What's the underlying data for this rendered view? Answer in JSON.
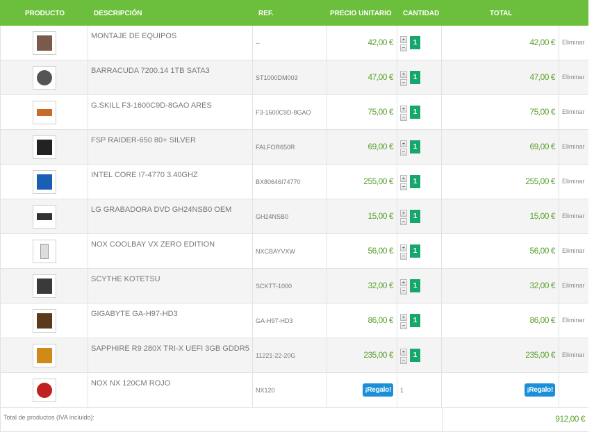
{
  "header": {
    "producto": "PRODUCTO",
    "descripcion": "DESCRIPCIÓN",
    "ref": "REF.",
    "precio": "PRECIO UNITARIO",
    "cantidad": "CANTIDAD",
    "total": "TOTAL"
  },
  "controls": {
    "plus": "+",
    "minus": "−",
    "delete": "Eliminar"
  },
  "items": [
    {
      "name": "MONTAJE DE EQUIPOS",
      "ref": "--",
      "price": "42,00 €",
      "qty": "1",
      "total": "42,00 €",
      "icon": "pc-assembly-icon",
      "color": "#7a5a4a"
    },
    {
      "name": "BARRACUDA 7200.14 1TB SATA3",
      "ref": "ST1000DM003",
      "price": "47,00 €",
      "qty": "1",
      "total": "47,00 €",
      "icon": "hard-drive-icon",
      "color": "#555555"
    },
    {
      "name": "G.SKILL F3-1600C9D-8GAO ARES",
      "ref": "F3-1600C9D-8GAO",
      "price": "75,00 €",
      "qty": "1",
      "total": "75,00 €",
      "icon": "ram-module-icon",
      "color": "#c86a2a"
    },
    {
      "name": "FSP RAIDER-650 80+ SILVER",
      "ref": "FALFOR650R",
      "price": "69,00 €",
      "qty": "1",
      "total": "69,00 €",
      "icon": "power-supply-icon",
      "color": "#222222"
    },
    {
      "name": "INTEL CORE I7-4770 3.40GHZ",
      "ref": "BX80646I74770",
      "price": "255,00 €",
      "qty": "1",
      "total": "255,00 €",
      "icon": "cpu-box-icon",
      "color": "#1a5fb4"
    },
    {
      "name": "LG GRABADORA DVD GH24NSB0 OEM",
      "ref": "GH24NSB0",
      "price": "15,00 €",
      "qty": "1",
      "total": "15,00 €",
      "icon": "dvd-drive-icon",
      "color": "#333333"
    },
    {
      "name": "NOX COOLBAY VX ZERO EDITION",
      "ref": "NXCBAYVXW",
      "price": "56,00 €",
      "qty": "1",
      "total": "56,00 €",
      "icon": "pc-case-icon",
      "color": "#dddddd"
    },
    {
      "name": "SCYTHE KOTETSU",
      "ref": "SCKTT-1000",
      "price": "32,00 €",
      "qty": "1",
      "total": "32,00 €",
      "icon": "cpu-cooler-icon",
      "color": "#3a3a3a"
    },
    {
      "name": "GIGABYTE GA-H97-HD3",
      "ref": "GA-H97-HD3",
      "price": "86,00 €",
      "qty": "1",
      "total": "86,00 €",
      "icon": "motherboard-icon",
      "color": "#5a3a1a"
    },
    {
      "name": "SAPPHIRE R9 280X TRI-X UEFI 3GB GDDR5",
      "ref": "11221-22-20G",
      "price": "235,00 €",
      "qty": "1",
      "total": "235,00 €",
      "icon": "graphics-card-icon",
      "color": "#d08a1a"
    },
    {
      "name": "NOX NX 120CM ROJO",
      "ref": "NX120",
      "price": "¡Regalo!",
      "qty": "1",
      "total": "¡Regalo!",
      "icon": "case-fan-icon",
      "color": "#c02020",
      "gift": true
    }
  ],
  "summary": {
    "label": "Total de productos (IVA incluido):",
    "value": "912,00 €"
  },
  "colors": {
    "header": "#6cbf3c",
    "price": "#5aa02c",
    "qty": "#17a76c",
    "badge": "#1b8fd8"
  }
}
